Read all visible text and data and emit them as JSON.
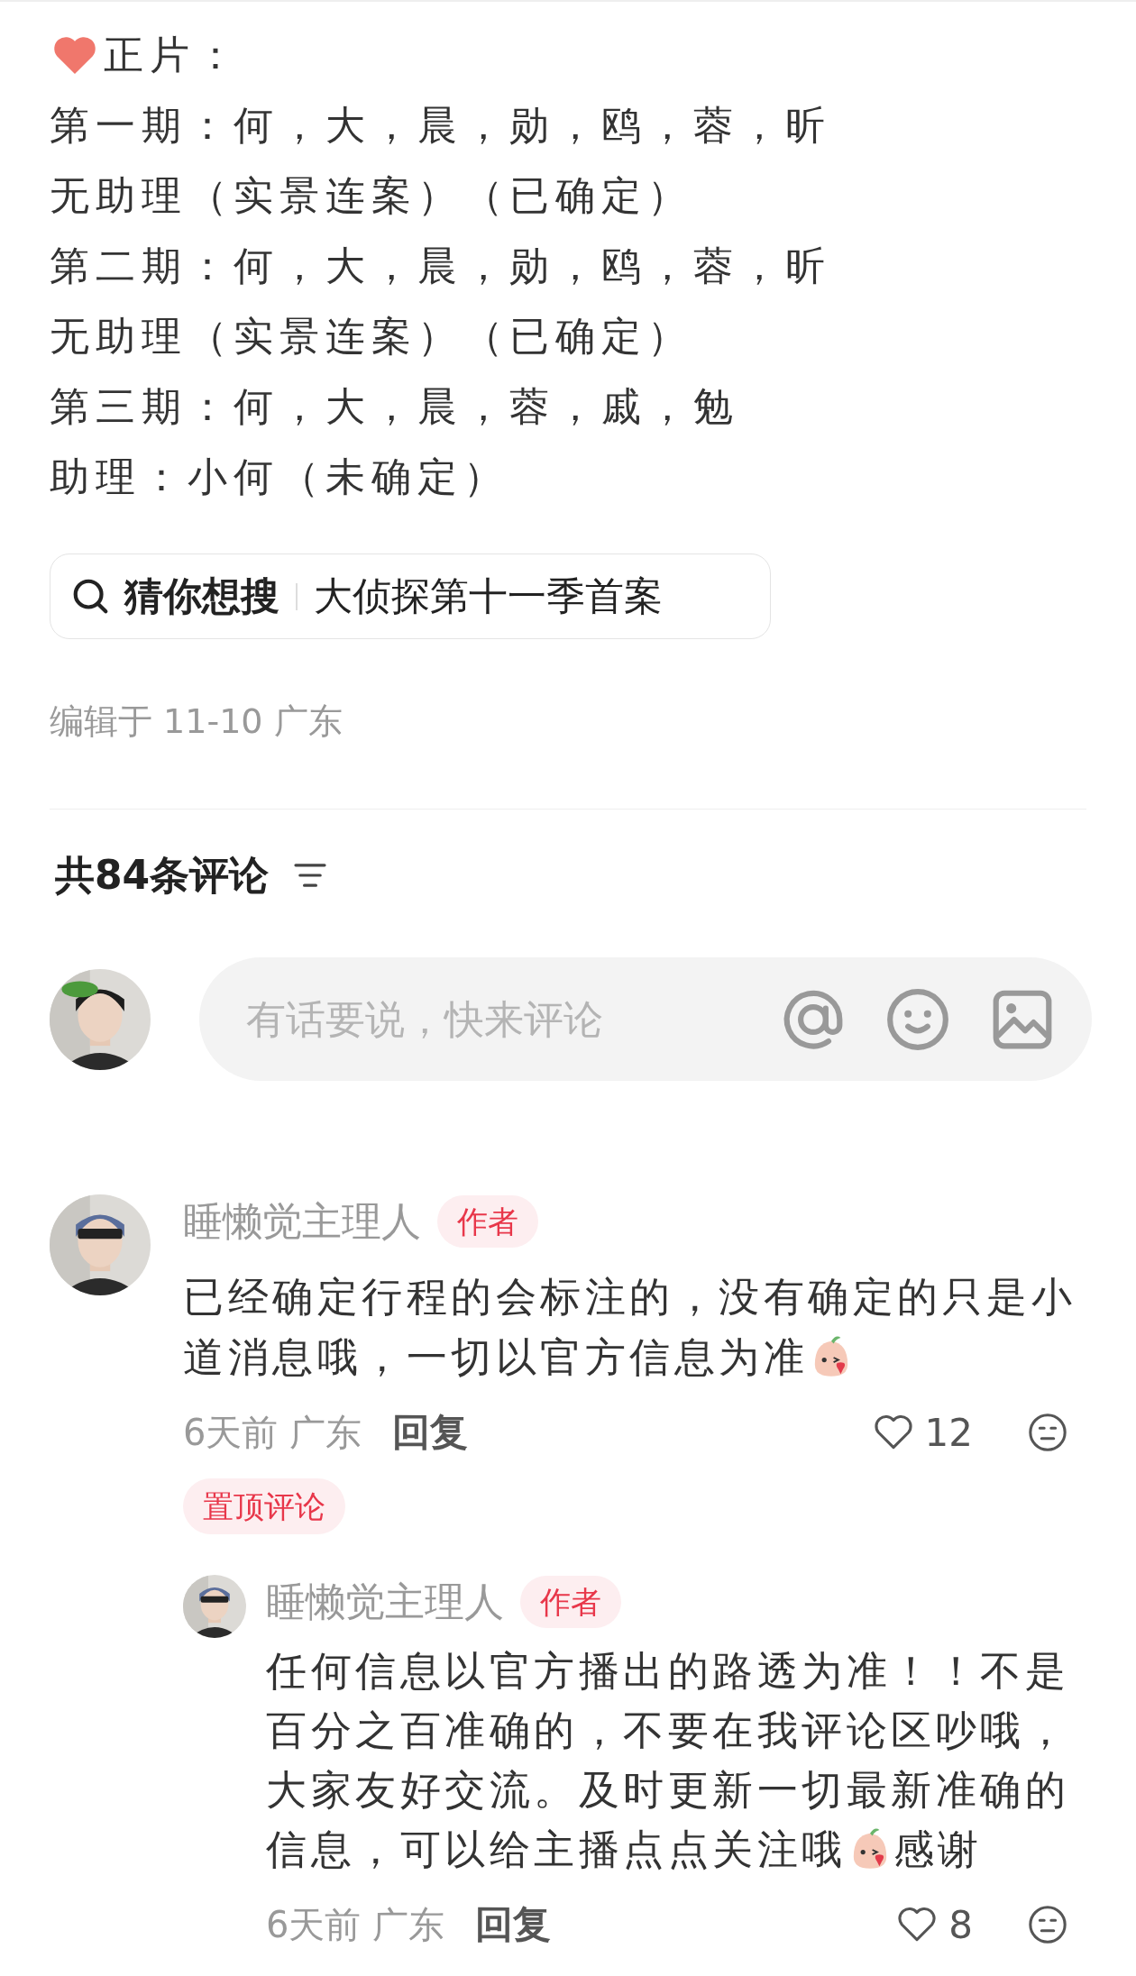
{
  "post": {
    "lines": [
      "正片：",
      "第一期：何，大，晨，勋，鸥，蓉，昕",
      "无助理（实景连案）（已确定）",
      "第二期：何，大，晨，勋，鸥，蓉，昕",
      "无助理（实景连案）（已确定）",
      "第三期：何，大，晨，蓉，戚，勉",
      "助理：小何（未确定）"
    ],
    "search_suggestion": {
      "label": "猜你想搜",
      "query": "大侦探第十一季首案"
    },
    "edited": "编辑于 11-10 广东"
  },
  "comments_header": {
    "title": "共84条评论"
  },
  "comment_input": {
    "placeholder": "有话要说，快来评论"
  },
  "comments": [
    {
      "author": "睡懒觉主理人",
      "badge": "作者",
      "body": [
        [
          {
            "kind": "text",
            "text": "已经确定行程的会标注的，没有确定的只是小"
          }
        ],
        [
          {
            "kind": "text",
            "text": "道消息哦，一切以官方信息为准"
          },
          {
            "kind": "sticker"
          }
        ]
      ],
      "meta": "6天前 广东",
      "reply_label": "回复",
      "likes": "12",
      "pinned": "置顶评论",
      "replies": [
        {
          "author": "睡懒觉主理人",
          "badge": "作者",
          "body": [
            [
              {
                "kind": "text",
                "text": "任何信息以官方播出的路透为准！！不是"
              }
            ],
            [
              {
                "kind": "text",
                "text": "百分之百准确的，不要在我评论区吵哦，"
              }
            ],
            [
              {
                "kind": "text",
                "text": "大家友好交流。及时更新一切最新准确的"
              }
            ],
            [
              {
                "kind": "text",
                "text": "信息，可以给主播点点关注哦"
              },
              {
                "kind": "sticker"
              },
              {
                "kind": "text",
                "text": "感谢"
              }
            ]
          ],
          "meta": "6天前 广东",
          "reply_label": "回复",
          "likes": "8"
        }
      ]
    }
  ]
}
